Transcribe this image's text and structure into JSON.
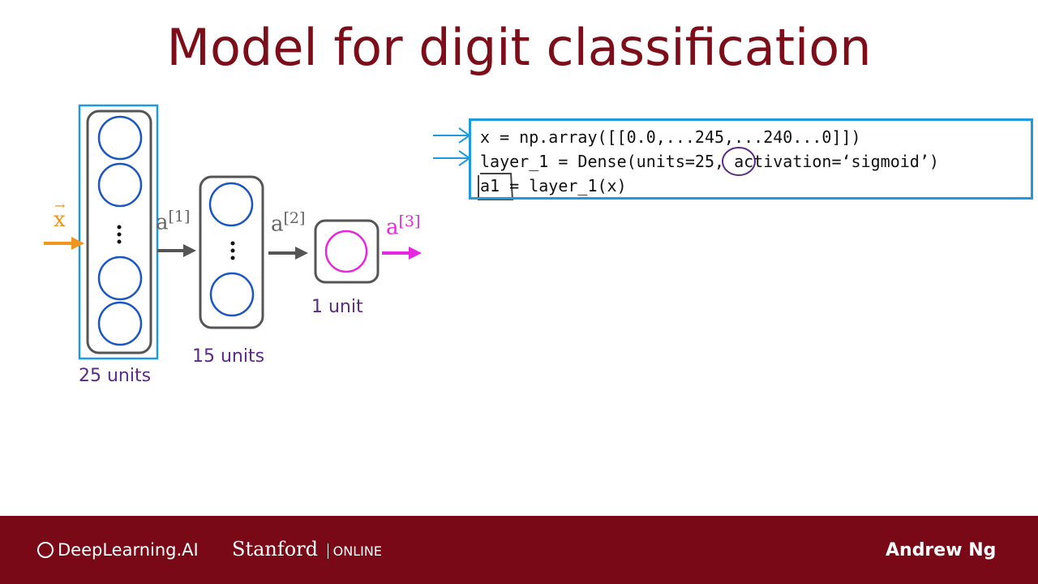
{
  "title": "Model for digit classification",
  "network": {
    "input_label": "x",
    "layers": [
      {
        "activation_label": "a",
        "index": "[1]",
        "units_label": "25 units"
      },
      {
        "activation_label": "a",
        "index": "[2]",
        "units_label": "15 units"
      },
      {
        "activation_label": "a",
        "index": "[3]",
        "units_label": "1 unit"
      }
    ],
    "colors": {
      "input": "#f0961e",
      "neuron": "#1a56c4",
      "output": "#e826e0",
      "highlight": "#1e9be0",
      "units_text": "#5b2a86"
    }
  },
  "code": {
    "lines": [
      "x = np.array([[0.0,...245,...240...0]])",
      "layer_1 = Dense(units=25, activation=‘sigmoid’)",
      "a1 = layer_1(x)"
    ]
  },
  "footer": {
    "brand_left": "DeepLearning.AI",
    "brand_mid": "Stanford",
    "brand_mid_sub": "ONLINE",
    "author": "Andrew Ng"
  }
}
